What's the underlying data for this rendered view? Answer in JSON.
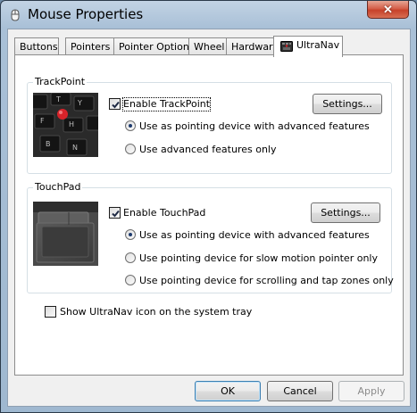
{
  "window": {
    "title": "Mouse Properties",
    "close_glyph": "✕",
    "title_icon": "mouse-icon"
  },
  "tabs": [
    {
      "label": "Buttons",
      "active": false
    },
    {
      "label": "Pointers",
      "active": false
    },
    {
      "label": "Pointer Options",
      "active": false
    },
    {
      "label": "Wheel",
      "active": false
    },
    {
      "label": "Hardware",
      "active": false
    },
    {
      "label": "UltraNav",
      "active": true,
      "icon": "ultranav-icon"
    }
  ],
  "trackpoint": {
    "group_title": "TrackPoint",
    "enable_label": "Enable TrackPoint",
    "enabled": true,
    "settings_label": "Settings...",
    "options": [
      {
        "label": "Use as pointing device with advanced features",
        "selected": true
      },
      {
        "label": "Use advanced features only",
        "selected": false
      }
    ]
  },
  "touchpad": {
    "group_title": "TouchPad",
    "enable_label": "Enable TouchPad",
    "enabled": true,
    "settings_label": "Settings...",
    "options": [
      {
        "label": "Use as pointing device with advanced features",
        "selected": true
      },
      {
        "label": "Use pointing device for slow motion pointer only",
        "selected": false
      },
      {
        "label": "Use pointing device for scrolling and tap zones only",
        "selected": false
      }
    ]
  },
  "tray_option": {
    "label": "Show UltraNav icon on the system tray",
    "checked": false
  },
  "footer": {
    "ok_label": "OK",
    "cancel_label": "Cancel",
    "apply_label": "Apply"
  },
  "colors": {
    "trackpoint_red": "#d8232a",
    "default_button_border": "#3c7fb1",
    "close_button": "#c7412a"
  }
}
